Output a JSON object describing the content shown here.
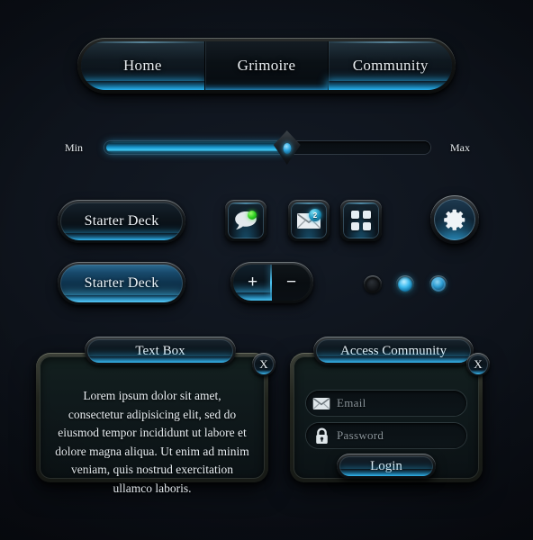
{
  "nav": {
    "tabs": [
      {
        "label": "Home",
        "state": "active"
      },
      {
        "label": "Grimoire",
        "state": "inactive"
      },
      {
        "label": "Community",
        "state": "active"
      }
    ]
  },
  "slider": {
    "min_label": "Min",
    "max_label": "Max",
    "value_percent": 56,
    "handle_icon": "diamond-gem-handle"
  },
  "buttons": {
    "starter_deck_normal": "Starter Deck",
    "starter_deck_active": "Starter Deck"
  },
  "icon_buttons": [
    {
      "name": "chat-icon",
      "badge": "",
      "badge_type": "dot-green"
    },
    {
      "name": "mail-icon",
      "badge": "2",
      "badge_type": "count-blue"
    },
    {
      "name": "grid-icon",
      "badge": "",
      "badge_type": "none"
    }
  ],
  "gear_button": {
    "icon": "gear-icon"
  },
  "stepper": {
    "increment_label": "+",
    "decrement_label": "−"
  },
  "radios": [
    {
      "state": "off"
    },
    {
      "state": "on"
    },
    {
      "state": "on-secondary"
    }
  ],
  "text_panel": {
    "title": "Text Box",
    "close_label": "X",
    "body": "Lorem ipsum dolor sit amet, consectetur adipisicing elit, sed do eiusmod tempor incididunt ut labore et dolore magna aliqua. Ut enim ad minim veniam, quis nostrud exercitation ullamco laboris."
  },
  "login_panel": {
    "title": "Access Community",
    "close_label": "X",
    "email": {
      "icon": "envelope-icon",
      "value": "",
      "placeholder": "Email"
    },
    "password": {
      "icon": "lock-icon",
      "value": "",
      "placeholder": "Password"
    },
    "submit_label": "Login"
  },
  "colors": {
    "background": "#0d121a",
    "accent_cyan": "#35b6ef",
    "accent_blue": "#1892c9",
    "text_primary": "#eef3f7",
    "text_muted": "#8a949a",
    "badge_green": "#2fd222",
    "panel_border": "#3c4038"
  }
}
